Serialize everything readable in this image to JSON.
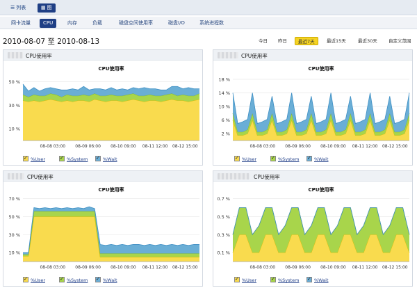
{
  "viewmode": {
    "list_label": "列表",
    "graph_label": "图"
  },
  "tabs": [
    {
      "label": "网卡流量",
      "active": false
    },
    {
      "label": "CPU",
      "active": true
    },
    {
      "label": "内存",
      "active": false
    },
    {
      "label": "负载",
      "active": false
    },
    {
      "label": "磁盘空间使用率",
      "active": false
    },
    {
      "label": "磁盘I/O",
      "active": false
    },
    {
      "label": "系统进程数",
      "active": false
    }
  ],
  "date_range": "2010-08-07 至 2010-08-13",
  "range_buttons": [
    {
      "label": "今日",
      "active": false
    },
    {
      "label": "昨日",
      "active": false
    },
    {
      "label": "最近7天",
      "active": true
    },
    {
      "label": "最近15天",
      "active": false
    },
    {
      "label": "最近30天",
      "active": false
    },
    {
      "label": "自定义范围",
      "active": false
    }
  ],
  "legend": [
    "%User",
    "%System",
    "%Wait"
  ],
  "colors": {
    "user": "#f9db4e",
    "system": "#a8d54b",
    "wait": "#6aaed6",
    "accent": "#1f3f85",
    "active_range": "#f5d323"
  },
  "chart_data": [
    {
      "type": "area",
      "header": "CPU使用率",
      "title": "CPU使用率",
      "stacked": true,
      "x_ticks": [
        "08-08 03:00",
        "08-09 06:00",
        "08-10 09:00",
        "08-11 12:00",
        "08-12 15:00"
      ],
      "y_ticks": [
        "10 %",
        "30 %",
        "50 %"
      ],
      "ylim": [
        0,
        55
      ],
      "series": [
        {
          "name": "%User",
          "values": [
            34,
            33,
            34,
            33,
            34,
            35,
            34,
            33,
            34,
            33,
            34,
            34,
            33,
            35,
            34,
            33,
            34,
            34,
            33,
            34,
            35,
            34,
            33,
            34,
            34,
            33,
            34,
            35,
            34,
            34,
            33,
            34,
            35
          ]
        },
        {
          "name": "%System",
          "values": [
            5,
            4,
            5,
            5,
            4,
            5,
            5,
            4,
            5,
            5,
            4,
            5,
            5,
            5,
            4,
            5,
            5,
            4,
            5,
            5,
            5,
            4,
            5,
            5,
            4,
            5,
            5,
            5,
            4,
            5,
            5,
            4,
            5
          ]
        },
        {
          "name": "%Wait",
          "values": [
            9,
            5,
            6,
            4,
            6,
            5,
            5,
            6,
            4,
            6,
            5,
            7,
            5,
            4,
            6,
            5,
            6,
            5,
            6,
            4,
            5,
            6,
            7,
            5,
            6,
            5,
            4,
            6,
            8,
            5,
            7,
            6,
            4
          ]
        }
      ]
    },
    {
      "type": "area",
      "header": "CPU使用率",
      "title": "CPU使用率",
      "stacked": true,
      "x_ticks": [
        "08-08 03:00",
        "08-09 06:00",
        "08-10 09:00",
        "08-11 12:00",
        "08-12 15:00"
      ],
      "y_ticks": [
        "2 %",
        "6 %",
        "10 %",
        "14 %",
        "18 %"
      ],
      "ylim": [
        0,
        19
      ],
      "series": [
        {
          "name": "%User",
          "values": [
            6,
            1.5,
            1.5,
            2,
            6,
            1.5,
            1.5,
            2,
            6,
            1.5,
            1.5,
            2,
            6,
            1.5,
            1.5,
            2,
            6,
            1.5,
            1.5,
            2,
            6,
            1.5,
            1.5,
            2,
            6,
            1.5,
            1.5,
            2,
            6,
            1.5,
            1.5,
            2,
            6,
            1.5,
            1.5,
            2,
            6
          ]
        },
        {
          "name": "%System",
          "values": [
            2,
            1,
            1,
            1.2,
            2,
            1,
            1,
            1.2,
            2,
            1,
            1,
            1.2,
            2,
            1,
            1,
            1.2,
            2,
            1,
            1,
            1.2,
            2,
            1,
            1,
            1.2,
            2,
            1,
            1,
            1.2,
            2,
            1,
            1,
            1.2,
            2,
            1,
            1,
            1.2,
            2
          ]
        },
        {
          "name": "%Wait",
          "values": [
            6,
            2.5,
            3,
            3,
            6,
            2.5,
            3,
            3,
            5,
            2.5,
            3,
            3,
            6,
            2.5,
            3,
            3,
            5,
            2.5,
            3,
            3,
            6,
            2.5,
            3,
            3,
            5,
            2.5,
            3,
            3,
            6,
            2.5,
            3,
            3,
            5,
            2.5,
            3,
            3,
            6
          ]
        }
      ]
    },
    {
      "type": "area",
      "header": "CPU使用率",
      "title": "CPU使用率",
      "stacked": true,
      "x_ticks": [
        "08-08 03:00",
        "08-09 06:00",
        "08-10 09:00",
        "08-11 12:00",
        "08-12 15:00"
      ],
      "y_ticks": [
        "10 %",
        "30 %",
        "50 %",
        "70 %"
      ],
      "ylim": [
        0,
        72
      ],
      "series": [
        {
          "name": "%User",
          "values": [
            6,
            6,
            50,
            50,
            50,
            50,
            50,
            50,
            50,
            50,
            50,
            50,
            50,
            50,
            5,
            5,
            5,
            5,
            5,
            5,
            5,
            5,
            5,
            5,
            5,
            5,
            5,
            5,
            5,
            5,
            5,
            5,
            5
          ]
        },
        {
          "name": "%System",
          "values": [
            2,
            2,
            6,
            6,
            6,
            6,
            6,
            6,
            6,
            6,
            6,
            6,
            6,
            6,
            4,
            4,
            4,
            4,
            4,
            4,
            4,
            4,
            4,
            4,
            4,
            4,
            4,
            4,
            4,
            4,
            4,
            4,
            4
          ]
        },
        {
          "name": "%Wait",
          "values": [
            2,
            2,
            4,
            3,
            4,
            3,
            4,
            3,
            4,
            3,
            4,
            3,
            5,
            3,
            10,
            9,
            10,
            9,
            10,
            9,
            10,
            10,
            9,
            10,
            9,
            10,
            9,
            10,
            9,
            10,
            9,
            10,
            10
          ]
        }
      ]
    },
    {
      "type": "area",
      "header": "CPU使用率",
      "title": "CPU使用率",
      "stacked": true,
      "x_ticks": [
        "08-08 03:00",
        "08-09 06:00",
        "08-10 09:00",
        "08-11 12:00",
        "08-12 15:00"
      ],
      "y_ticks": [
        "0.1 %",
        "0.3 %",
        "0.5 %",
        "0.7 %"
      ],
      "ylim": [
        0,
        0.72
      ],
      "series": [
        {
          "name": "%User",
          "values": [
            0.1,
            0.3,
            0.3,
            0.1,
            0.1,
            0.3,
            0.3,
            0.1,
            0.1,
            0.3,
            0.3,
            0.1,
            0.1,
            0.3,
            0.3,
            0.1,
            0.1,
            0.3,
            0.3,
            0.1,
            0.1,
            0.3,
            0.3,
            0.1,
            0.1,
            0.3,
            0.3,
            0.1
          ]
        },
        {
          "name": "%System",
          "values": [
            0.2,
            0.3,
            0.3,
            0.2,
            0.3,
            0.3,
            0.3,
            0.2,
            0.3,
            0.3,
            0.3,
            0.2,
            0.3,
            0.3,
            0.3,
            0.2,
            0.3,
            0.3,
            0.3,
            0.2,
            0.3,
            0.3,
            0.3,
            0.2,
            0.3,
            0.3,
            0.3,
            0.2
          ]
        },
        {
          "name": "%Wait",
          "values": [
            0,
            0,
            0,
            0,
            0,
            0,
            0,
            0,
            0,
            0,
            0,
            0,
            0,
            0,
            0,
            0,
            0,
            0,
            0,
            0,
            0,
            0,
            0,
            0,
            0,
            0,
            0,
            0
          ]
        }
      ]
    }
  ]
}
